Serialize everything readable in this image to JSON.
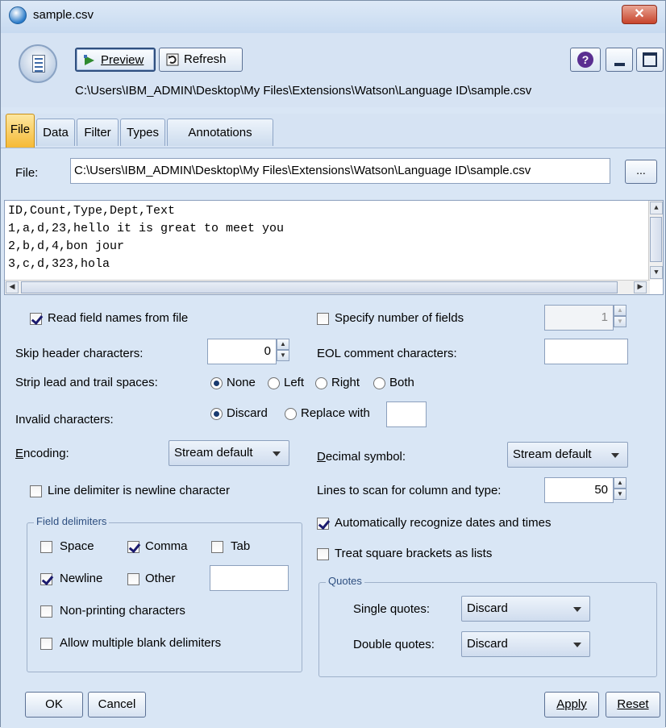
{
  "window": {
    "title": "sample.csv",
    "close_glyph": "✕"
  },
  "toolbar": {
    "preview_label": "Preview",
    "refresh_label": "Refresh",
    "help_glyph": "?",
    "path": "C:\\Users\\IBM_ADMIN\\Desktop\\My Files\\Extensions\\Watson\\Language ID\\sample.csv"
  },
  "tabs": [
    {
      "label": "File",
      "active": true
    },
    {
      "label": "Data"
    },
    {
      "label": "Filter"
    },
    {
      "label": "Types"
    },
    {
      "label": "Annotations"
    }
  ],
  "file": {
    "label": "File:",
    "value": "C:\\Users\\IBM_ADMIN\\Desktop\\My Files\\Extensions\\Watson\\Language ID\\sample.csv",
    "browse_label": "..."
  },
  "preview_lines": [
    "ID,Count,Type,Dept,Text",
    "1,a,d,23,hello it is great to meet you",
    "2,b,d,4,bon jour",
    "3,c,d,323,hola"
  ],
  "options": {
    "read_field_names": {
      "label": "Read field names from file",
      "checked": true
    },
    "specify_fields": {
      "label": "Specify number of fields",
      "checked": false,
      "value": "1"
    },
    "skip_header": {
      "label": "Skip header characters:",
      "value": "0"
    },
    "eol_comment": {
      "label": "EOL comment characters:",
      "value": ""
    },
    "strip": {
      "label": "Strip lead and trail spaces:",
      "options": [
        "None",
        "Left",
        "Right",
        "Both"
      ],
      "selected": "None"
    },
    "invalid": {
      "label": "Invalid characters:",
      "options": [
        "Discard",
        "Replace with"
      ],
      "selected": "Discard",
      "replace_value": ""
    },
    "encoding": {
      "label": "Encoding:",
      "value": "Stream default"
    },
    "decimal": {
      "label": "Decimal symbol:",
      "value": "Stream default"
    },
    "line_delim": {
      "label": "Line delimiter is newline character",
      "checked": false
    },
    "lines_to_scan": {
      "label": "Lines to scan for column and type:",
      "value": "50"
    },
    "auto_dates": {
      "label": "Automatically recognize dates and times",
      "checked": true
    },
    "square_brackets": {
      "label": "Treat square brackets as lists",
      "checked": false
    }
  },
  "field_delimiters": {
    "title": "Field delimiters",
    "space": {
      "label": "Space",
      "checked": false
    },
    "comma": {
      "label": "Comma",
      "checked": true
    },
    "tab": {
      "label": "Tab",
      "checked": false
    },
    "newline": {
      "label": "Newline",
      "checked": true
    },
    "other": {
      "label": "Other",
      "checked": false,
      "value": ""
    },
    "non_printing": {
      "label": "Non-printing characters",
      "checked": false
    },
    "multiple_blank": {
      "label": "Allow multiple blank delimiters",
      "checked": false
    }
  },
  "quotes": {
    "title": "Quotes",
    "single": {
      "label": "Single quotes:",
      "value": "Discard"
    },
    "double": {
      "label": "Double quotes:",
      "value": "Discard"
    }
  },
  "buttons": {
    "ok": "OK",
    "cancel": "Cancel",
    "apply": "Apply",
    "reset": "Reset"
  }
}
